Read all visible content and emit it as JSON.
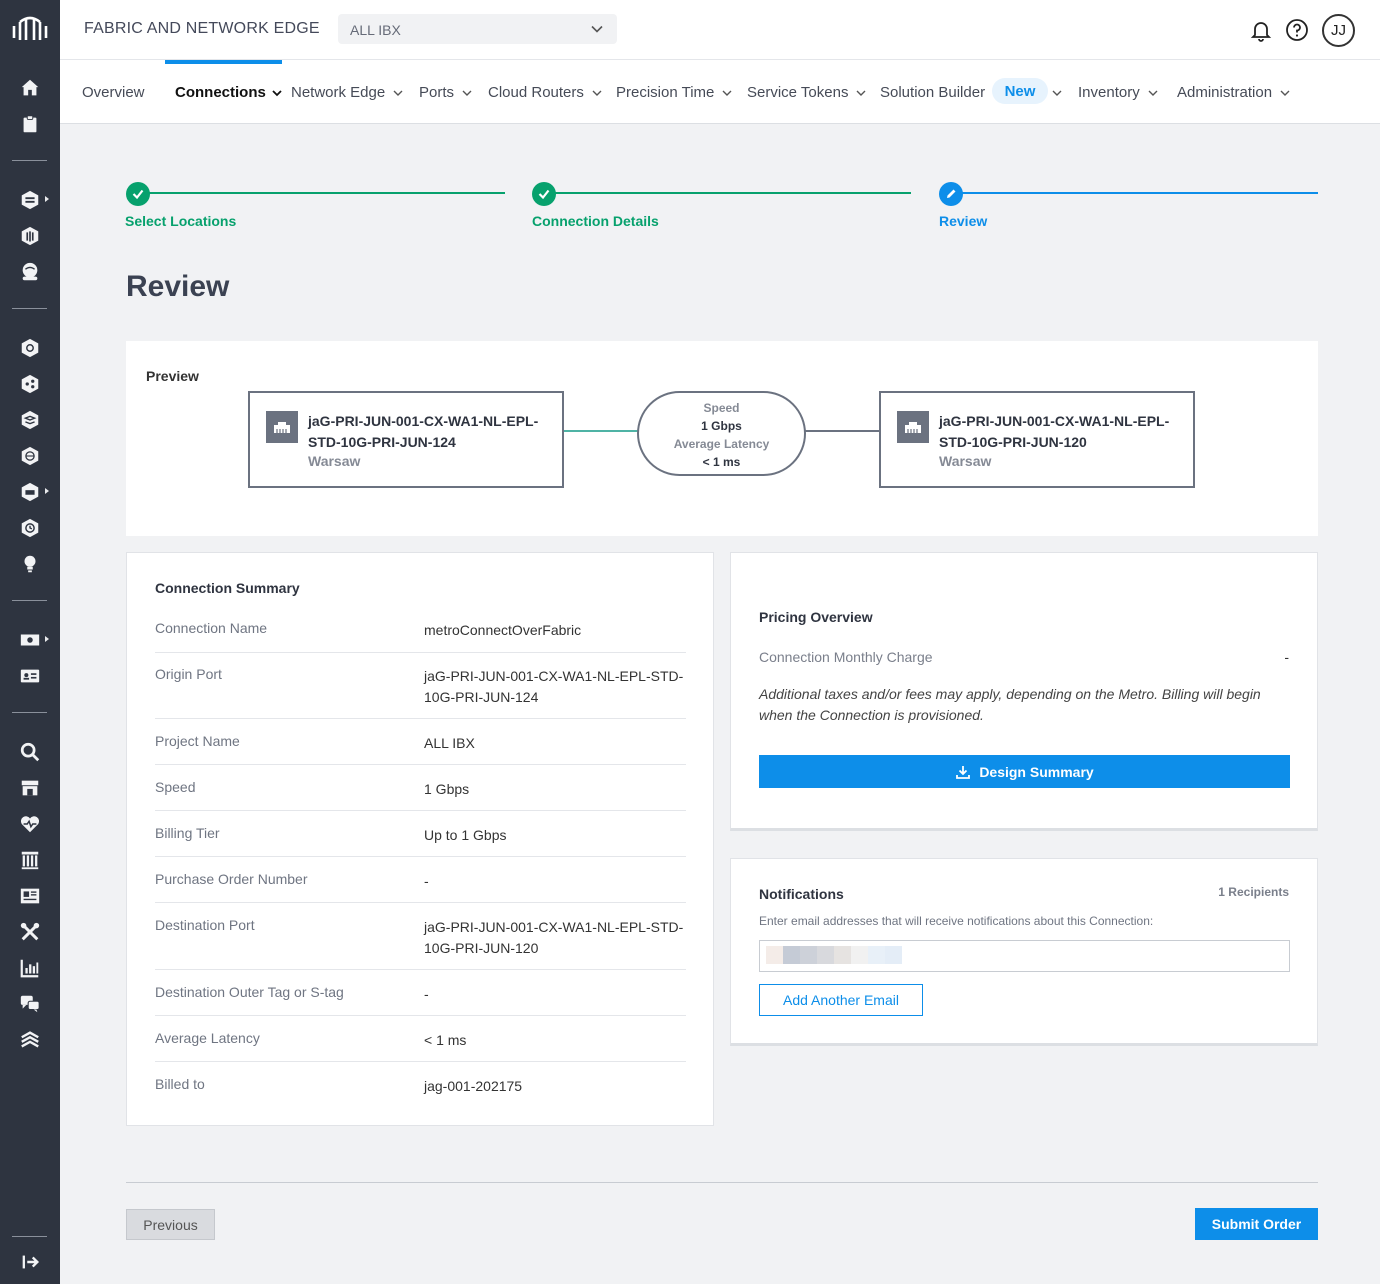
{
  "header": {
    "app_title": "FABRIC AND NETWORK EDGE",
    "ibx_select_value": "ALL IBX",
    "avatar_initials": "JJ"
  },
  "nav": {
    "items": [
      {
        "label": "Overview"
      },
      {
        "label": "Connections"
      },
      {
        "label": "Network Edge"
      },
      {
        "label": "Ports"
      },
      {
        "label": "Cloud Routers"
      },
      {
        "label": "Precision Time"
      },
      {
        "label": "Service Tokens"
      },
      {
        "label": "Solution Builder"
      },
      {
        "label": "Inventory"
      },
      {
        "label": "Administration"
      }
    ],
    "new_badge": "New"
  },
  "stepper": {
    "steps": [
      {
        "label": "Select Locations",
        "status": "complete"
      },
      {
        "label": "Connection Details",
        "status": "complete"
      },
      {
        "label": "Review",
        "status": "current"
      }
    ],
    "complete_color": "#07a16d",
    "current_color": "#0d8ee9"
  },
  "page": {
    "title": "Review"
  },
  "preview": {
    "label": "Preview",
    "origin": {
      "name": "jaG-PRI-JUN-001-CX-WA1-NL-EPL-STD-10G-PRI-JUN-124",
      "metro": "Warsaw"
    },
    "destination": {
      "name": "jaG-PRI-JUN-001-CX-WA1-NL-EPL-STD-10G-PRI-JUN-120",
      "metro": "Warsaw"
    },
    "speed_label": "Speed",
    "speed_value": "1 Gbps",
    "latency_label": "Average Latency",
    "latency_value": "< 1 ms"
  },
  "summary": {
    "title": "Connection Summary",
    "rows": [
      {
        "key": "Connection Name",
        "value": "metroConnectOverFabric"
      },
      {
        "key": "Origin Port",
        "value": "jaG-PRI-JUN-001-CX-WA1-NL-EPL-STD-10G-PRI-JUN-124"
      },
      {
        "key": "Project Name",
        "value": "ALL IBX"
      },
      {
        "key": "Speed",
        "value": "1 Gbps"
      },
      {
        "key": "Billing Tier",
        "value": "Up to 1 Gbps"
      },
      {
        "key": "Purchase Order Number",
        "value": "-"
      },
      {
        "key": "Destination Port",
        "value": "jaG-PRI-JUN-001-CX-WA1-NL-EPL-STD-10G-PRI-JUN-120"
      },
      {
        "key": "Destination Outer Tag or S-tag",
        "value": "-"
      },
      {
        "key": "Average Latency",
        "value": "< 1 ms"
      },
      {
        "key": "Billed to",
        "value": "jag-001-202175"
      }
    ]
  },
  "pricing": {
    "title": "Pricing Overview",
    "charge_label": "Connection Monthly Charge",
    "charge_value": "-",
    "note": "Additional taxes and/or fees may apply, depending on the Metro. Billing will begin when the Connection is provisioned.",
    "design_button": "Design Summary"
  },
  "notifications": {
    "title": "Notifications",
    "recipients": "1 Recipients",
    "instruction": "Enter email addresses that will receive notifications about this Connection:",
    "add_button": "Add Another Email"
  },
  "footer": {
    "previous_button": "Previous",
    "submit_button": "Submit Order"
  },
  "colors": {
    "accent": "#0d8ee9",
    "success": "#07a16d",
    "rail": "#2e3440"
  }
}
